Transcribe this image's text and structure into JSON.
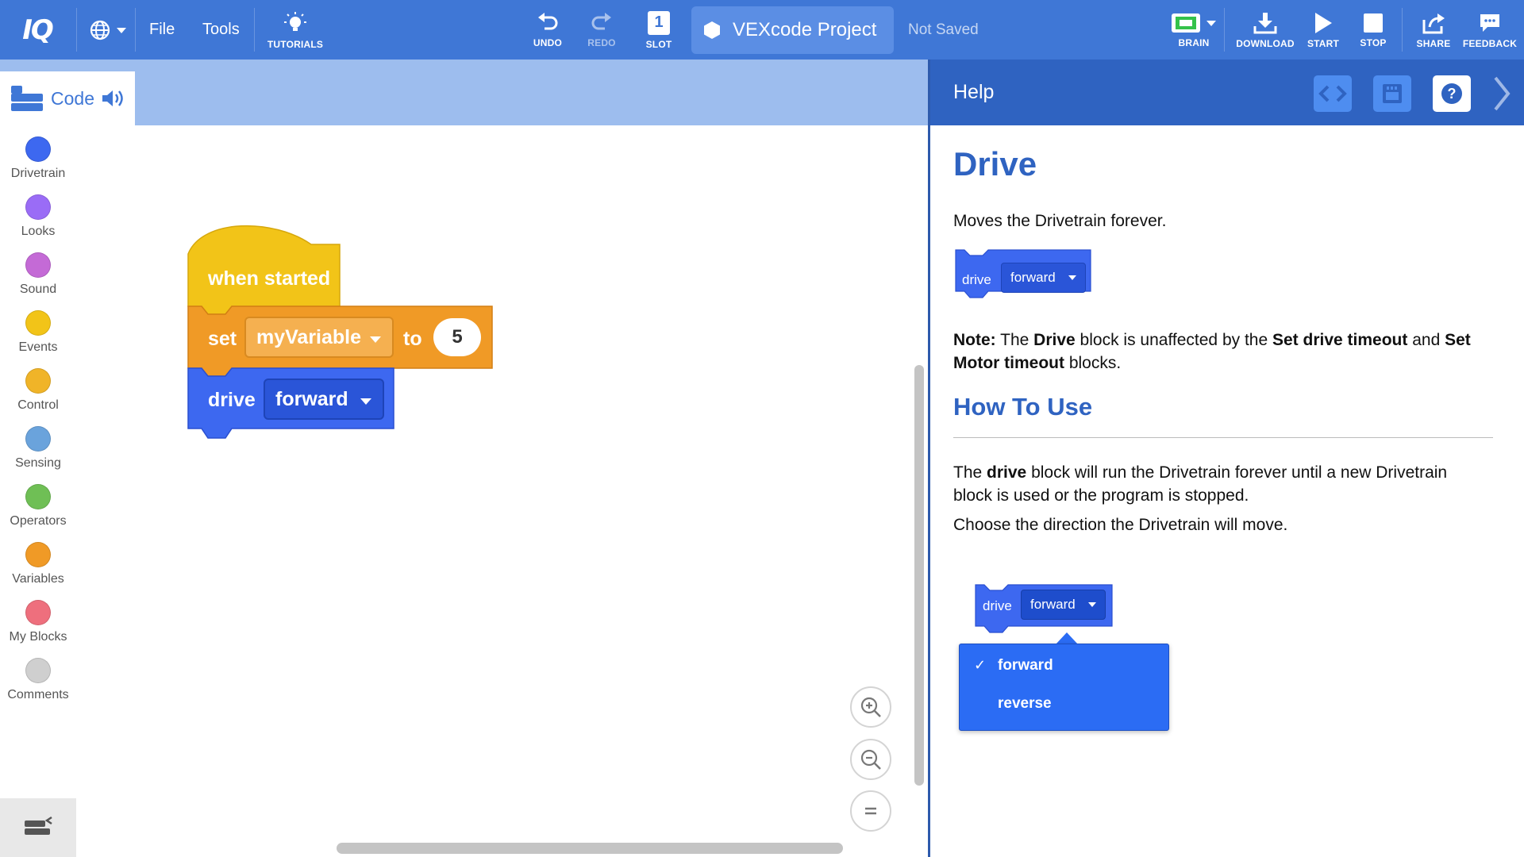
{
  "app": {
    "logo": "IQ"
  },
  "toolbar": {
    "globe_icon": "globe-icon",
    "menus": [
      {
        "label": "File"
      },
      {
        "label": "Tools"
      }
    ],
    "tutorials_label": "TUTORIALS",
    "undo_label": "UNDO",
    "redo_label": "REDO",
    "slot_label": "SLOT",
    "slot_number": "1",
    "project_name": "VEXcode Project",
    "save_status": "Not Saved",
    "brain_label": "BRAIN",
    "download_label": "DOWNLOAD",
    "start_label": "START",
    "stop_label": "STOP",
    "share_label": "SHARE",
    "feedback_label": "FEEDBACK"
  },
  "palette": {
    "tab_label": "Code",
    "categories": [
      {
        "label": "Drivetrain",
        "color": "#3d68f0"
      },
      {
        "label": "Looks",
        "color": "#9a6cf6"
      },
      {
        "label": "Sound",
        "color": "#c46ad6"
      },
      {
        "label": "Events",
        "color": "#f2c418"
      },
      {
        "label": "Control",
        "color": "#f0b428"
      },
      {
        "label": "Sensing",
        "color": "#6aa3dc"
      },
      {
        "label": "Operators",
        "color": "#6fbf55"
      },
      {
        "label": "Variables",
        "color": "#f09a26"
      },
      {
        "label": "My Blocks",
        "color": "#ee6f7d"
      },
      {
        "label": "Comments",
        "color": "#cfcfcf"
      }
    ]
  },
  "workspace": {
    "hat_block": {
      "text": "when started",
      "color": "#f2c418"
    },
    "set_block": {
      "set": "set",
      "variable": "myVariable",
      "to": "to",
      "value": "5",
      "color": "#f09a26"
    },
    "drive_block": {
      "drive": "drive",
      "direction": "forward",
      "color": "#3d68f0"
    }
  },
  "help": {
    "title": "Help",
    "heading": "Drive",
    "description": "Moves the Drivetrain forever.",
    "example_block": {
      "drive": "drive",
      "direction": "forward"
    },
    "note_label": "Note:",
    "note_t1": "The",
    "note_b1": "Drive",
    "note_t2": "block is unaffected by the",
    "note_b2": "Set drive timeout",
    "note_t3": "and",
    "note_b3": "Set Motor timeout",
    "note_t4": "blocks.",
    "how_to_heading": "How To Use",
    "usage_t1": "The",
    "usage_b1": "drive",
    "usage_t2": "block will run the Drivetrain forever until a new Drivetrain block is used or the program is stopped.",
    "direction_text": "Choose the direction the Drivetrain will move.",
    "dropdown_block": {
      "drive": "drive",
      "direction": "forward"
    },
    "dropdown_options": [
      {
        "label": "forward",
        "checked": "✓"
      },
      {
        "label": "reverse"
      }
    ]
  }
}
